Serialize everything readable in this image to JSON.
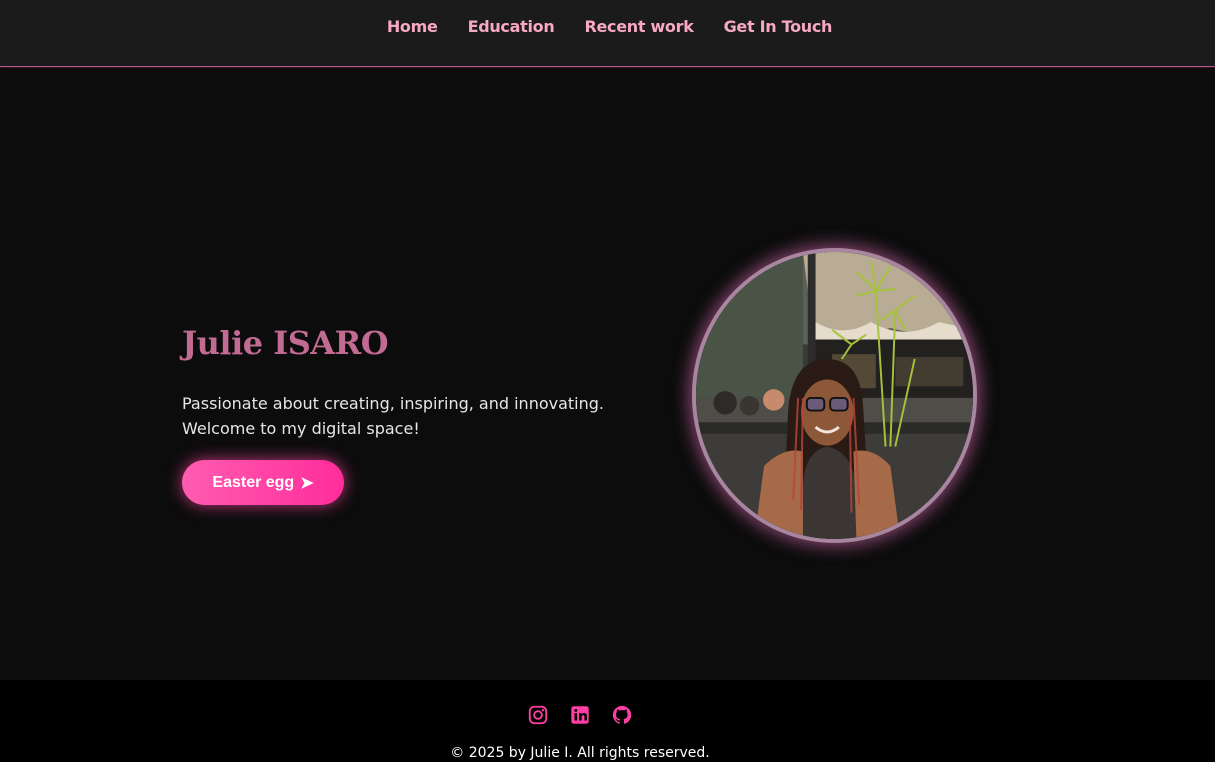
{
  "nav": {
    "items": [
      {
        "label": "Home"
      },
      {
        "label": "Education"
      },
      {
        "label": "Recent work"
      },
      {
        "label": "Get In Touch"
      }
    ]
  },
  "hero": {
    "name": "Julie ISARO",
    "tagline_line1": "Passionate about creating, inspiring, and innovating.",
    "tagline_line2": "Welcome to my digital space!",
    "cta_label": "Easter egg",
    "cta_icon": "➤"
  },
  "footer": {
    "socials": [
      "instagram-icon",
      "linkedin-icon",
      "github-icon"
    ],
    "copyright": "© 2025 by Julie I. All rights reserved."
  },
  "colors": {
    "accent": "#ff3fa4",
    "nav_text": "#f7a8c4",
    "name": "#c16b93",
    "background": "#0c0c0c"
  }
}
